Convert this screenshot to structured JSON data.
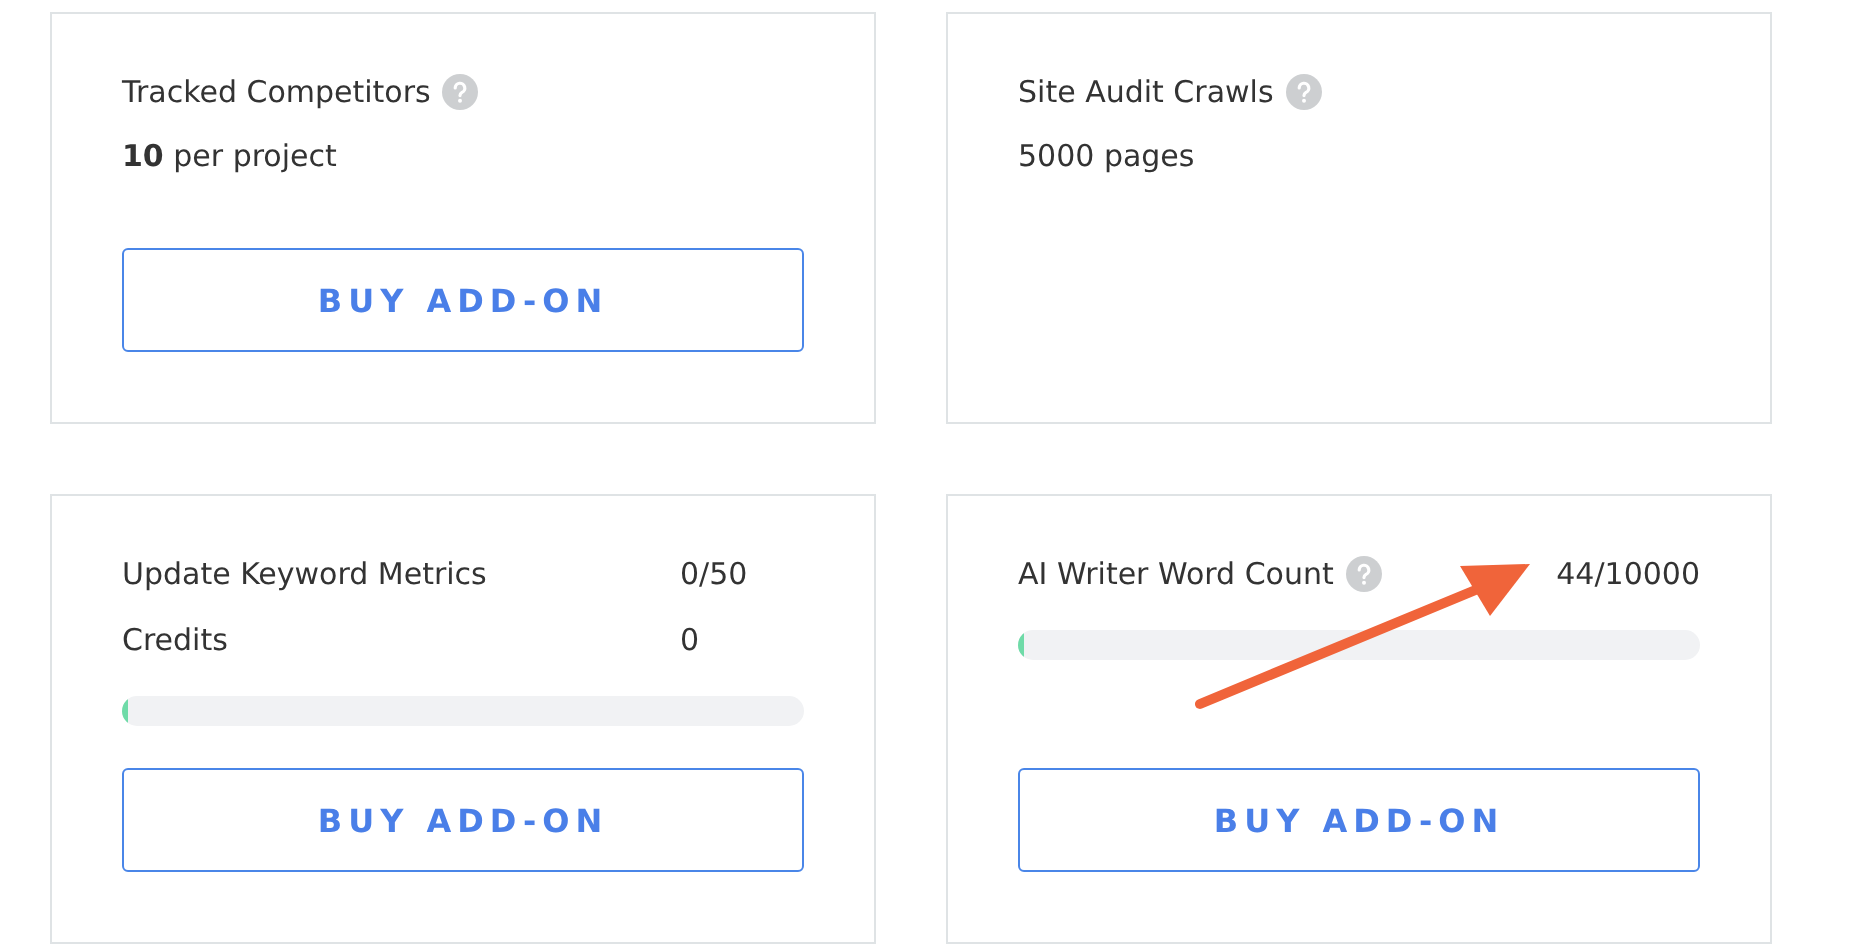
{
  "cards": [
    {
      "title": "Tracked Competitors",
      "help": true,
      "value": "**10** per project",
      "button": "BUY ADD-ON"
    },
    {
      "title": "Site Audit Crawls",
      "help": true,
      "value": "5000 pages"
    },
    {
      "rows": [
        {
          "label": "Update Keyword Metrics",
          "help": false,
          "reading": "0/50"
        },
        {
          "label": "Credits",
          "help": false,
          "reading": "0"
        }
      ],
      "level": 0,
      "button": "BUY ADD-ON"
    },
    {
      "rows": [
        {
          "label": "AI Writer Word Count",
          "help": true,
          "reading": "44/10000"
        }
      ],
      "level": 0.0044,
      "button": "BUY ADD-ON"
    }
  ]
}
